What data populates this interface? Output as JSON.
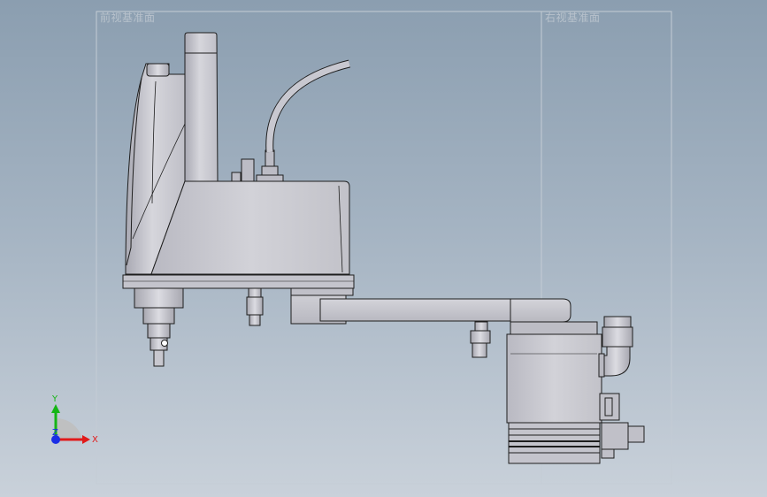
{
  "viewport": {
    "background_top": "#8b9eb0",
    "background_bottom": "#c9d1da",
    "model_fill": "#c8c8cf",
    "model_edge": "#1e1e1e"
  },
  "planes": {
    "front_plane_label": "前视基准面",
    "right_plane_label": "右视基准面"
  },
  "triad": {
    "x_label": "X",
    "y_label": "Y",
    "z_label": "Z",
    "x_color": "#e11a1a",
    "y_color": "#15b515",
    "z_color": "#1a2ee6"
  }
}
